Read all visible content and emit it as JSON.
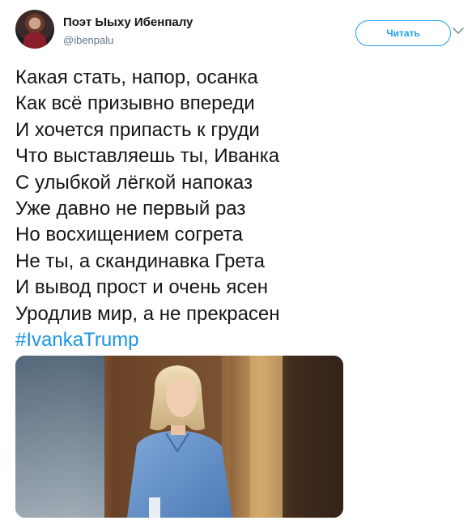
{
  "user": {
    "display_name": "Поэт Ыыху Ибенпалу",
    "handle": "@ibenpalu"
  },
  "follow_button": {
    "label": "Читать"
  },
  "icons": {
    "menu": "chevron-down-icon",
    "avatar": "user-avatar"
  },
  "colors": {
    "accent": "#1da1f2",
    "hashtag": "#1b95e0",
    "text": "#14171a",
    "muted": "#657786"
  },
  "tweet": {
    "lines": [
      "Какая стать, напор, осанка",
      "Как всё призывно впереди",
      "И хочется припасть к груди",
      "Что выставляешь ты, Иванка",
      "С улыбкой лёгкой напоказ",
      "Уже давно не первый раз",
      "Но восхищением согрета",
      "Не ты, а скандинавка Грета",
      "И вывод прост и очень ясен",
      "Уродлив мир, а не прекрасен"
    ],
    "hashtag": "#IvankaTrump"
  }
}
